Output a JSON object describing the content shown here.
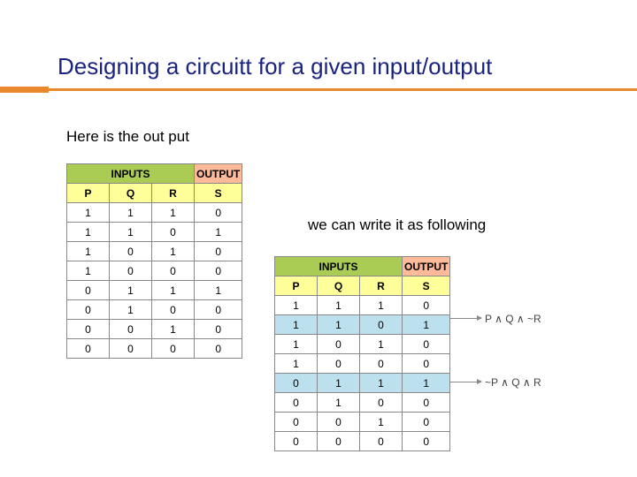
{
  "title": "Designing a circuitt for a given input/output",
  "subtitle": "Here is the out put",
  "caption2": "we can write it as following",
  "group_labels": {
    "inputs": "INPUTS",
    "output": "OUTPUT"
  },
  "columns": [
    "P",
    "Q",
    "R",
    "S"
  ],
  "chart_data": [
    {
      "type": "table",
      "title": "truth-table-1",
      "headers": {
        "inputs": "INPUTS",
        "output": "OUTPUT"
      },
      "columns": [
        "P",
        "Q",
        "R",
        "S"
      ],
      "rows": [
        [
          1,
          1,
          1,
          0
        ],
        [
          1,
          1,
          0,
          1
        ],
        [
          1,
          0,
          1,
          0
        ],
        [
          1,
          0,
          0,
          0
        ],
        [
          0,
          1,
          1,
          1
        ],
        [
          0,
          1,
          0,
          0
        ],
        [
          0,
          0,
          1,
          0
        ],
        [
          0,
          0,
          0,
          0
        ]
      ]
    },
    {
      "type": "table",
      "title": "truth-table-2",
      "headers": {
        "inputs": "INPUTS",
        "output": "OUTPUT"
      },
      "columns": [
        "P",
        "Q",
        "R",
        "S"
      ],
      "highlighted_row_indices": [
        1,
        4
      ],
      "rows": [
        [
          1,
          1,
          1,
          0
        ],
        [
          1,
          1,
          0,
          1
        ],
        [
          1,
          0,
          1,
          0
        ],
        [
          1,
          0,
          0,
          0
        ],
        [
          0,
          1,
          1,
          1
        ],
        [
          0,
          1,
          0,
          0
        ],
        [
          0,
          0,
          1,
          0
        ],
        [
          0,
          0,
          0,
          0
        ]
      ],
      "annotations": [
        {
          "row_index": 1,
          "text": "P ∧ Q ∧ ~R"
        },
        {
          "row_index": 4,
          "text": "~P ∧ Q ∧ R"
        }
      ]
    }
  ]
}
